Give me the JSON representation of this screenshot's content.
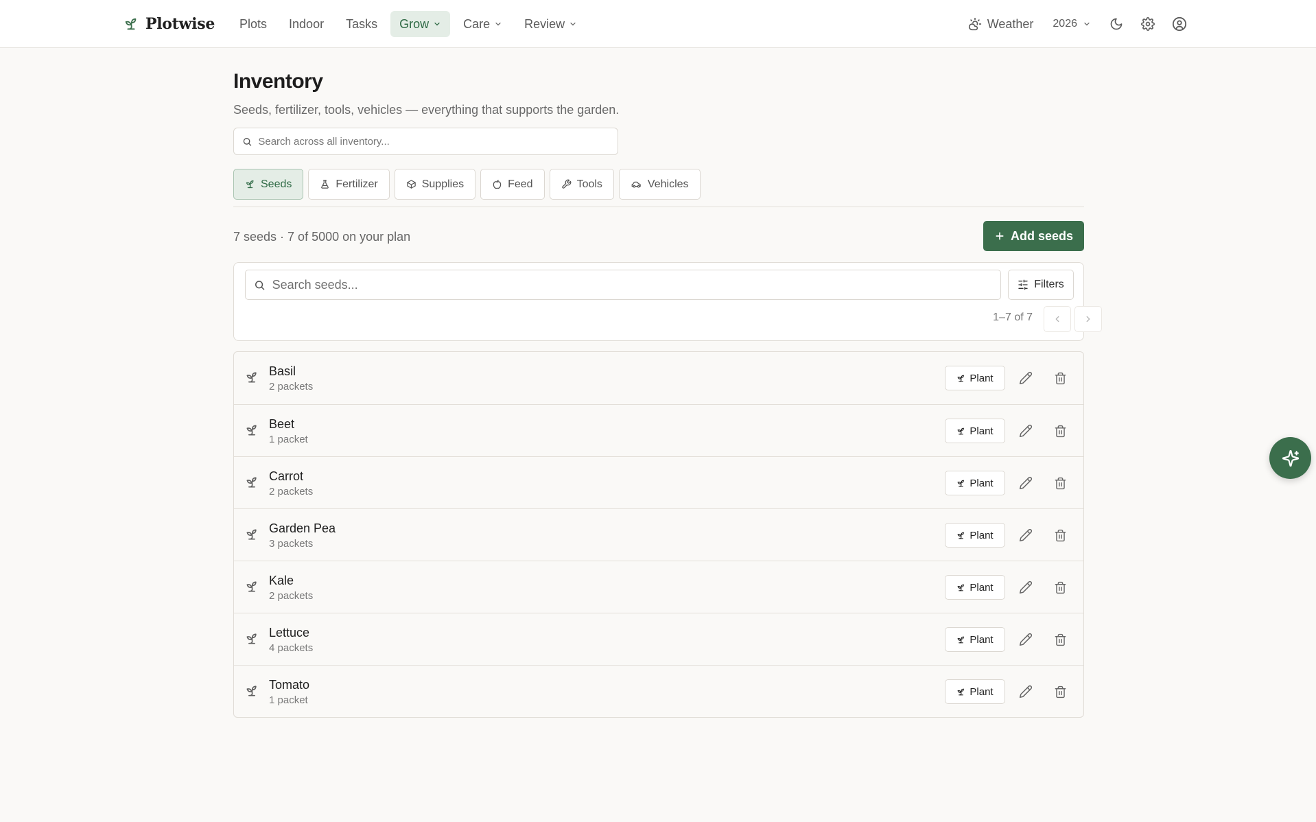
{
  "app": {
    "name": "Plotwise"
  },
  "nav": {
    "items": [
      {
        "label": "Plots",
        "has_menu": false,
        "active": false
      },
      {
        "label": "Indoor",
        "has_menu": false,
        "active": false
      },
      {
        "label": "Tasks",
        "has_menu": false,
        "active": false
      },
      {
        "label": "Grow",
        "has_menu": true,
        "active": true
      },
      {
        "label": "Care",
        "has_menu": true,
        "active": false
      },
      {
        "label": "Review",
        "has_menu": true,
        "active": false
      }
    ]
  },
  "toolbar": {
    "weather_label": "Weather",
    "year": "2026",
    "icons": [
      "weather-icon",
      "moon-icon",
      "gear-icon",
      "user-icon"
    ]
  },
  "page": {
    "title": "Inventory",
    "subtitle": "Seeds, fertilizer, tools, vehicles — everything that supports the garden.",
    "search_placeholder": "Search across all inventory..."
  },
  "categories": [
    {
      "label": "Seeds",
      "icon": "sprout-icon",
      "active": true
    },
    {
      "label": "Fertilizer",
      "icon": "flask-icon",
      "active": false
    },
    {
      "label": "Supplies",
      "icon": "box-icon",
      "active": false
    },
    {
      "label": "Feed",
      "icon": "apple-icon",
      "active": false
    },
    {
      "label": "Tools",
      "icon": "wrench-icon",
      "active": false
    },
    {
      "label": "Vehicles",
      "icon": "car-icon",
      "active": false
    }
  ],
  "summary": {
    "count_text": "7 seeds · 7 of 5000 on your plan",
    "add_label": "Add seeds"
  },
  "seed_search": {
    "placeholder": "Search seeds...",
    "filters_label": "Filters",
    "pager_text": "1–7 of 7"
  },
  "seeds": [
    {
      "name": "Basil",
      "qty": "2 packets"
    },
    {
      "name": "Beet",
      "qty": "1 packet"
    },
    {
      "name": "Carrot",
      "qty": "2 packets"
    },
    {
      "name": "Garden Pea",
      "qty": "3 packets"
    },
    {
      "name": "Kale",
      "qty": "2 packets"
    },
    {
      "name": "Lettuce",
      "qty": "4 packets"
    },
    {
      "name": "Tomato",
      "qty": "1 packet"
    }
  ],
  "row_actions": {
    "plant_label": "Plant"
  },
  "colors": {
    "accent": "#3b6e4c",
    "accent_soft": "#e4ede6",
    "background": "#faf9f7"
  }
}
